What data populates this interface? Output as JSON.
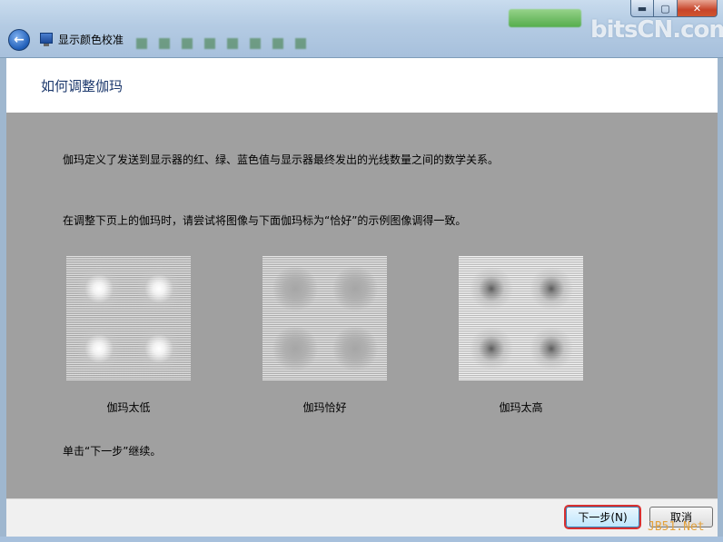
{
  "window": {
    "title": "显示颜色校准",
    "minimize_symbol": "▬",
    "maximize_symbol": "▢",
    "close_symbol": "✕",
    "back_symbol": "←",
    "watermark_top": "bitsCN.com",
    "watermark_bottom": "JB51.Net"
  },
  "header": {
    "title": "如何调整伽玛"
  },
  "content": {
    "paragraph1": "伽玛定义了发送到显示器的红、绿、蓝色值与显示器最终发出的光线数量之间的数学关系。",
    "paragraph2": "在调整下页上的伽玛时，请尝试将图像与下面伽玛标为“恰好”的示例图像调得一致。",
    "samples": [
      {
        "caption": "伽玛太低"
      },
      {
        "caption": "伽玛恰好"
      },
      {
        "caption": "伽玛太高"
      }
    ],
    "paragraph3": "单击“下一步”继续。"
  },
  "footer": {
    "next_label": "下一步(N)",
    "cancel_label": "取消"
  },
  "colors": {
    "accent": "#1e3a6e",
    "highlight": "#d83030",
    "content_bg": "#a0a0a0"
  }
}
